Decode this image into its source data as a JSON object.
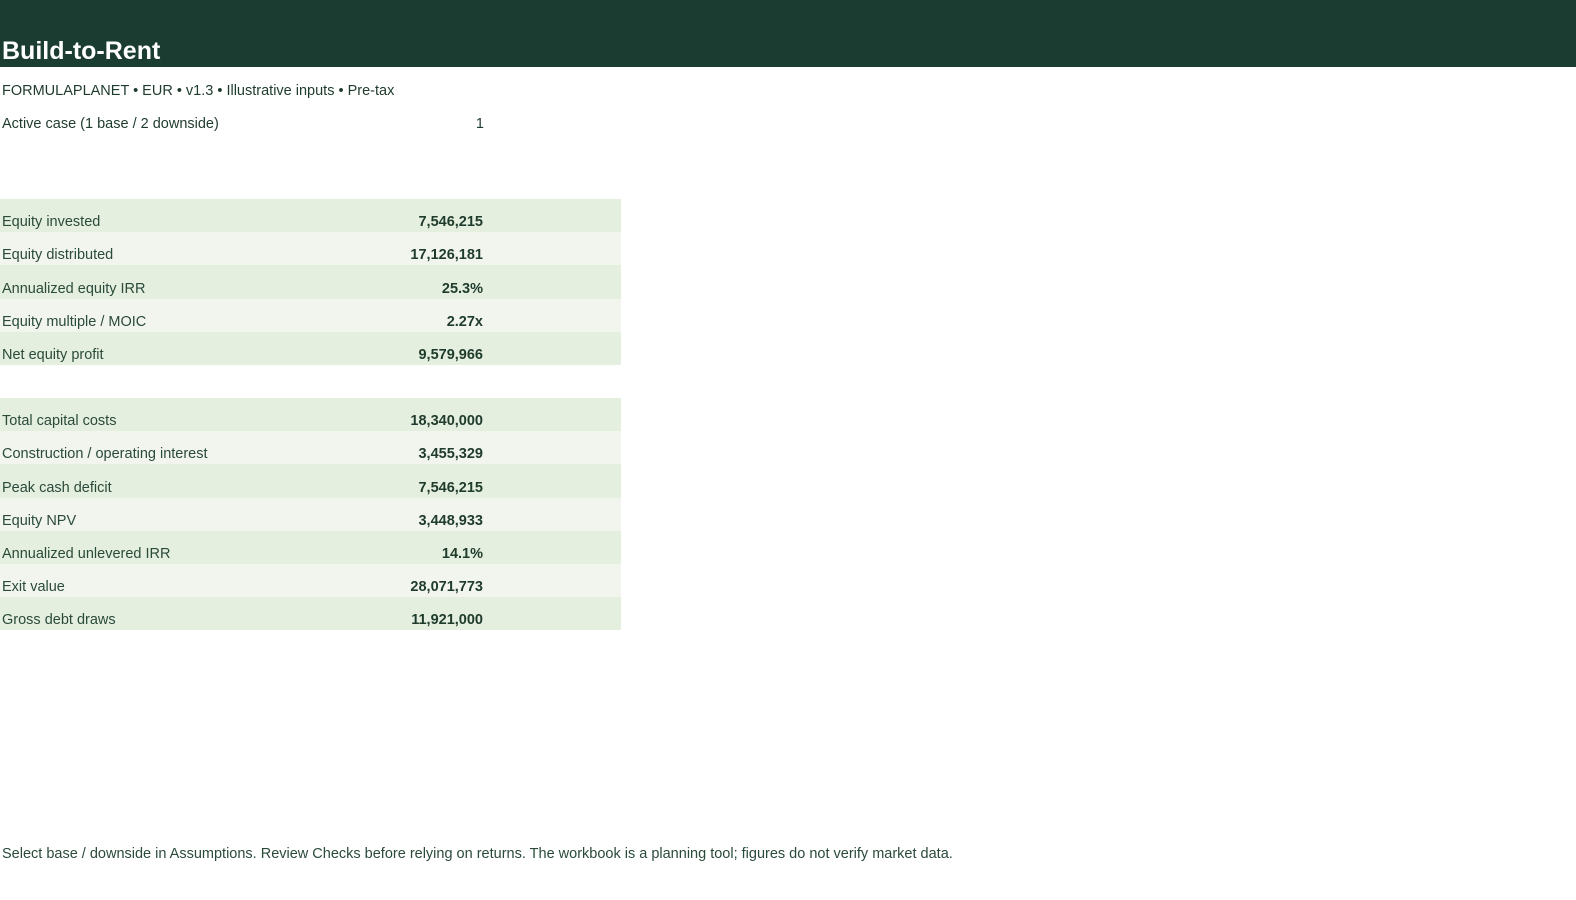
{
  "header": {
    "title": "Build-to-Rent",
    "subtitle": "FORMULAPLANET  •  EUR  •  v1.3  •  Illustrative inputs  •  Pre-tax"
  },
  "active_case": {
    "label": "Active case (1 base / 2 downside)",
    "value": "1"
  },
  "equity_metrics": [
    {
      "label": "Equity invested",
      "value": "7,546,215"
    },
    {
      "label": "Equity distributed",
      "value": "17,126,181"
    },
    {
      "label": "Annualized equity IRR",
      "value": "25.3%"
    },
    {
      "label": "Equity multiple / MOIC",
      "value": "2.27x"
    },
    {
      "label": "Net equity profit",
      "value": "9,579,966"
    }
  ],
  "project_metrics": [
    {
      "label": "Total capital costs",
      "value": "18,340,000"
    },
    {
      "label": "Construction / operating interest",
      "value": "3,455,329"
    },
    {
      "label": "Peak cash deficit",
      "value": "7,546,215"
    },
    {
      "label": "Equity NPV",
      "value": "3,448,933"
    },
    {
      "label": "Annualized unlevered IRR",
      "value": "14.1%"
    },
    {
      "label": "Exit value",
      "value": "28,071,773"
    },
    {
      "label": "Gross debt draws",
      "value": "11,921,000"
    }
  ],
  "footer": {
    "note": "Select base / downside in Assumptions. Review Checks before relying on returns. The workbook is a planning tool; figures do not verify market data."
  },
  "colors": {
    "header_band": "#1a3c31",
    "row_odd": "#e5efdf",
    "row_even": "#f1f5ed",
    "text": "#1f3b2c"
  }
}
